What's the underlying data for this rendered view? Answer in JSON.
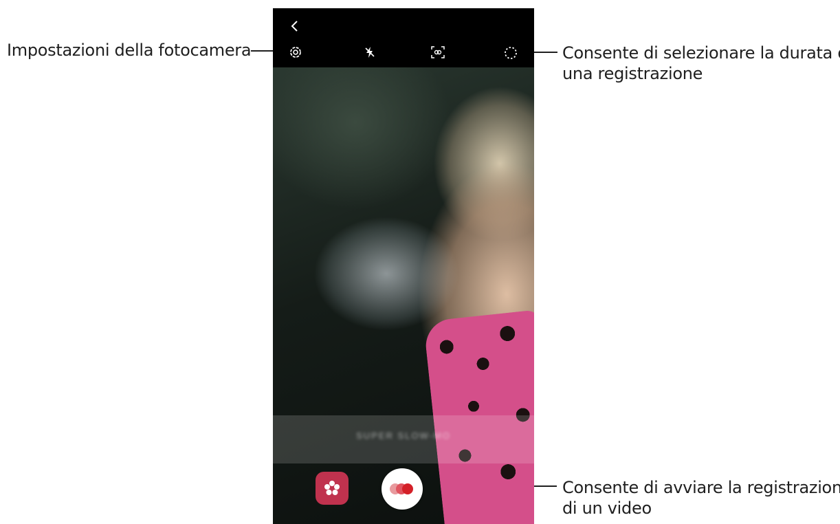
{
  "callouts": {
    "settings": {
      "line1": "Impostazioni della fotocamera"
    },
    "duration": {
      "line1": "Consente di selezionare la durata di",
      "line2": "una registrazione"
    },
    "record": {
      "line1": "Consente di avviare la registrazione",
      "line2": "di un video"
    }
  },
  "camera_ui": {
    "top_icons": [
      "back-icon",
      "settings-icon",
      "flash-off-icon",
      "motion-detection-icon",
      "recording-duration-icon"
    ],
    "mode_label": "SUPER SLOW-MO",
    "effects_button_icon": "effects-icon",
    "record_button_icon": "record-icon",
    "colors": {
      "effects_button": "#c0324e",
      "record_dots": [
        "#e89a9e",
        "#e05560",
        "#d42028"
      ]
    }
  }
}
